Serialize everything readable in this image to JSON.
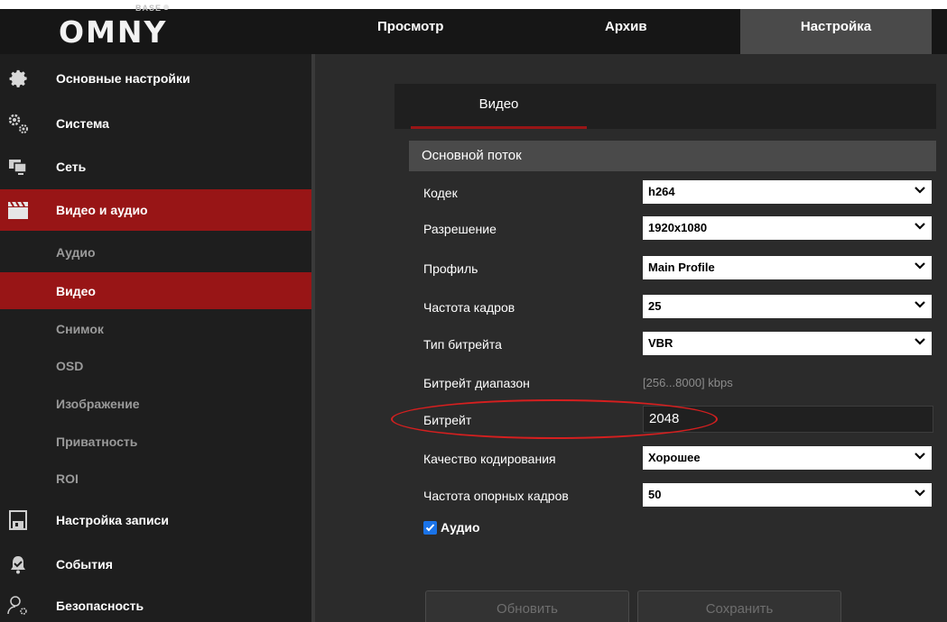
{
  "header": {
    "logo_sup": "BASE",
    "logo": "OMNY",
    "nav": {
      "view": "Просмотр",
      "archive": "Архив",
      "settings": "Настройка"
    }
  },
  "sidebar": {
    "items": {
      "basic": "Основные настройки",
      "system": "Система",
      "network": "Сеть",
      "video_audio": "Видео и аудио",
      "record": "Настройка записи",
      "events": "События",
      "security": "Безопасность"
    },
    "sub": {
      "audio": "Аудио",
      "video": "Видео",
      "snapshot": "Снимок",
      "osd": "OSD",
      "image": "Изображение",
      "privacy": "Приватность",
      "roi": "ROI"
    }
  },
  "main": {
    "tab": "Видео",
    "section": "Основной поток",
    "codec": {
      "label": "Кодек",
      "value": "h264"
    },
    "resolution": {
      "label": "Разрешение",
      "value": "1920x1080"
    },
    "profile": {
      "label": "Профиль",
      "value": "Main Profile"
    },
    "framerate": {
      "label": "Частота кадров",
      "value": "25"
    },
    "bitrate_type": {
      "label": "Тип битрейта",
      "value": "VBR"
    },
    "bitrate_range": {
      "label": "Битрейт диапазон",
      "value": "[256...8000] kbps"
    },
    "bitrate": {
      "label": "Битрейт",
      "value": "2048"
    },
    "quality": {
      "label": "Качество кодирования",
      "value": "Хорошее"
    },
    "gop": {
      "label": "Частота опорных кадров",
      "value": "50"
    },
    "audio_checkbox": {
      "label": "Аудио",
      "checked": true
    },
    "buttons": {
      "update": "Обновить",
      "save": "Сохранить"
    }
  },
  "colors": {
    "accent": "#981516",
    "background": "#2b2b2b",
    "sidebar": "#1e1e1e",
    "highlight": "#d51f1f",
    "checkbox": "#1a73e8"
  }
}
